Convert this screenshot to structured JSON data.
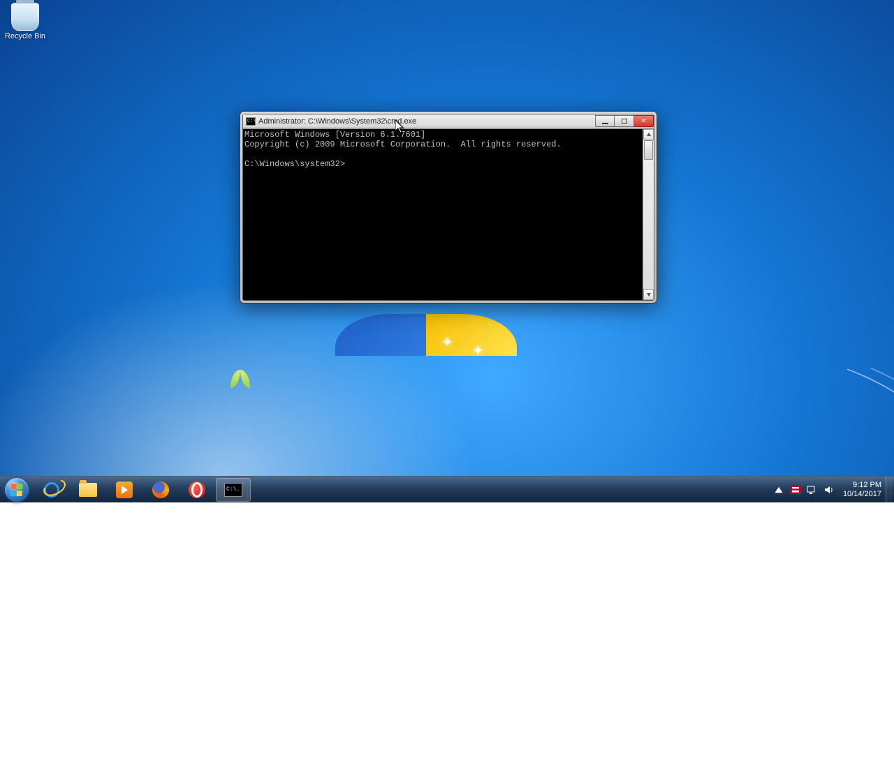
{
  "desktop": {
    "recycle_label": "Recycle Bin"
  },
  "cmd_window": {
    "title": "Administrator: C:\\Windows\\System32\\cmd.exe",
    "line1": "Microsoft Windows [Version 6.1.7601]",
    "line2": "Copyright (c) 2009 Microsoft Corporation.  All rights reserved.",
    "prompt": "C:\\Windows\\system32>"
  },
  "taskbar": {
    "pinned": [
      "Internet Explorer",
      "File Explorer",
      "Windows Media Player",
      "Firefox",
      "Opera"
    ],
    "running": "Command Prompt"
  },
  "tray": {
    "time": "9:12 PM",
    "date": "10/14/2017"
  }
}
